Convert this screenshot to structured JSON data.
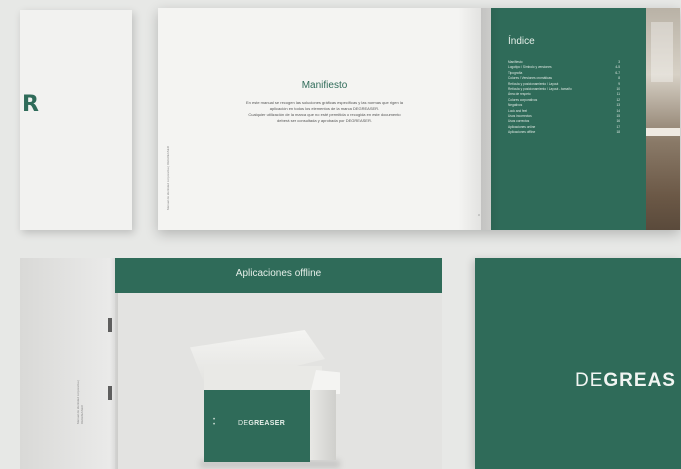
{
  "spread": {
    "left_logo_letter": "R",
    "manifesto": {
      "title": "Manifiesto",
      "body_line1": "En este manual se recogen las soluciones gráficas específicas y las normas que rigen la",
      "body_line2": "aplicación en todos los elementos de la marca DEGREASER.",
      "body_line3": "Cualquier utilización de la marca que no esté permitida o recogida en este documento",
      "body_line4": "deberá ser consultada y aprobada por DEGREASER.",
      "spine_text": "Manual de identidad corporativa | DEGREASER",
      "page_number": "3"
    },
    "index": {
      "title": "Índice",
      "items": [
        {
          "label": "Manifiesto",
          "page": "3"
        },
        {
          "label": "Logotipo / Símbolo y versiones",
          "page": "4-5"
        },
        {
          "label": "Tipografía",
          "page": "6-7"
        },
        {
          "label": "Colores / Versiones cromáticas",
          "page": "8"
        },
        {
          "label": "Retícula y posicionamiento / Layout",
          "page": "9"
        },
        {
          "label": "Retícula y posicionamiento / Layout - tamaño",
          "page": "10"
        },
        {
          "label": "Área de respeto",
          "page": "11"
        },
        {
          "label": "Colores corporativos",
          "page": "12"
        },
        {
          "label": "Negativos",
          "page": "13"
        },
        {
          "label": "Look and feel",
          "page": "14"
        },
        {
          "label": "Usos incorrectos",
          "page": "15"
        },
        {
          "label": "Usos correctos",
          "page": "16"
        },
        {
          "label": "Aplicaciones online",
          "page": "17"
        },
        {
          "label": "Aplicaciones offline",
          "page": "18"
        }
      ]
    }
  },
  "offline_page": {
    "title": "Aplicaciones offline",
    "spine_text": "Manual de identidad corporativa | DEGREASER",
    "box_logo_light": "DE",
    "box_logo_bold": "GREASER"
  },
  "cover": {
    "logo_light": "DE",
    "logo_bold": "GREAS"
  },
  "colors": {
    "brand_green": "#2f6b59",
    "paper": "#f4f4f2",
    "background": "#e7e8e6"
  }
}
